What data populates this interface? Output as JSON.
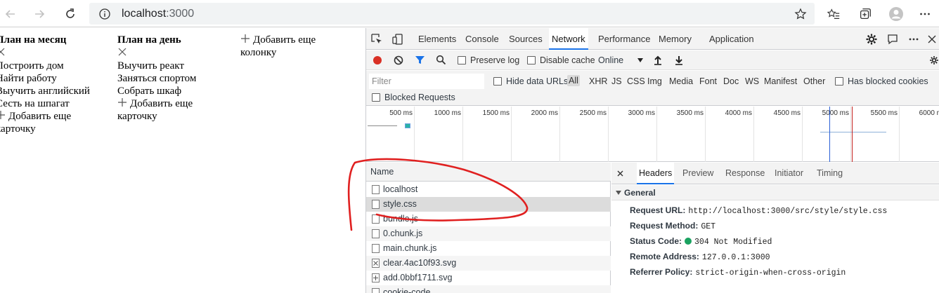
{
  "browser": {
    "url_host": "localhost",
    "url_port": ":3000"
  },
  "app": {
    "columns": [
      {
        "title": "План на месяц",
        "cards": [
          "Построить дом",
          "Найти работу",
          "Выучить английский",
          "Сесть на шпагат"
        ],
        "add_card": "Добавить еще карточку"
      },
      {
        "title": "План на день",
        "cards": [
          "Выучить реакт",
          "Заняться спортом",
          "Собрать шкаф"
        ],
        "add_card": "Добавить еще карточку"
      }
    ],
    "add_column": "Добавить еще колонку"
  },
  "devtools": {
    "tabs": [
      "Elements",
      "Console",
      "Sources",
      "Network",
      "Performance",
      "Memory",
      "Application"
    ],
    "active_tab": "Network",
    "toolbar": {
      "preserve_log": "Preserve log",
      "disable_cache": "Disable cache",
      "throttling": "Online"
    },
    "filter": {
      "placeholder": "Filter",
      "hide_data_urls": "Hide data URLs",
      "types": [
        "All",
        "XHR",
        "JS",
        "CSS",
        "Img",
        "Media",
        "Font",
        "Doc",
        "WS",
        "Manifest",
        "Other"
      ],
      "has_blocked_cookies": "Has blocked cookies",
      "blocked_requests": "Blocked Requests"
    },
    "overview_ticks": [
      "500 ms",
      "1000 ms",
      "1500 ms",
      "2000 ms",
      "2500 ms",
      "3000 ms",
      "3500 ms",
      "4000 ms",
      "4500 ms",
      "5000 ms",
      "5500 ms",
      "6000 ms"
    ],
    "requests": {
      "header": "Name",
      "rows": [
        "localhost",
        "style.css",
        "bundle.js",
        "0.chunk.js",
        "main.chunk.js",
        "clear.4ac10f93.svg",
        "add.0bbf1711.svg",
        "cookie-code..."
      ],
      "selected": "style.css"
    },
    "details": {
      "tabs": [
        "Headers",
        "Preview",
        "Response",
        "Initiator",
        "Timing"
      ],
      "active_tab": "Headers",
      "section": "General",
      "headers": [
        {
          "key": "Request URL:",
          "value": "http://localhost:3000/src/style/style.css"
        },
        {
          "key": "Request Method:",
          "value": "GET"
        },
        {
          "key": "Status Code:",
          "value": "304 Not Modified"
        },
        {
          "key": "Remote Address:",
          "value": "127.0.0.1:3000"
        },
        {
          "key": "Referrer Policy:",
          "value": "strict-origin-when-cross-origin"
        }
      ]
    }
  },
  "colors": {
    "accent": "#1a73e8",
    "record": "#d93025",
    "status_ok": "#1aa260",
    "annotation": "#e02020"
  }
}
